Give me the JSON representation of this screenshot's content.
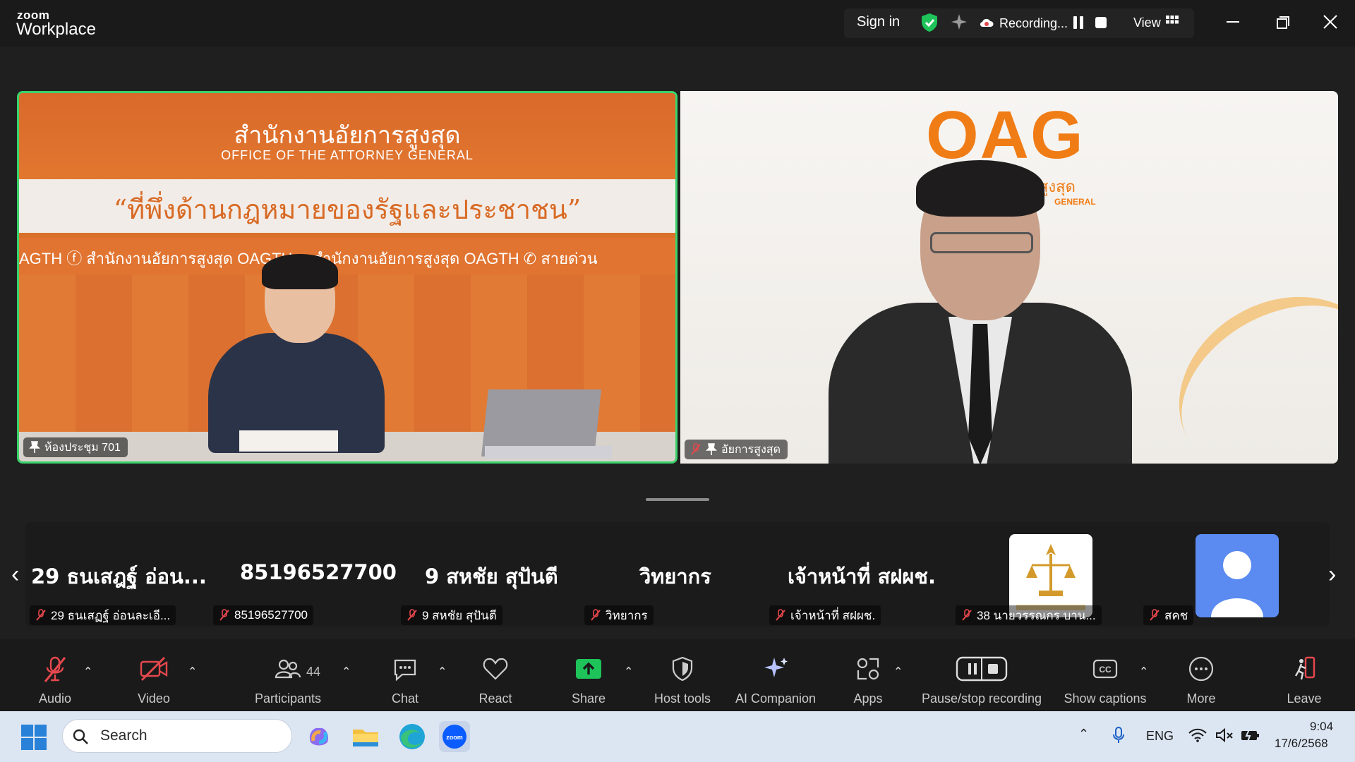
{
  "titlebar": {
    "brand_small": "zoom",
    "brand_big": "Workplace",
    "sign_in": "Sign in",
    "recording_label": "Recording...",
    "view_label": "View"
  },
  "video": {
    "left_scene": {
      "title_th": "สำนักงานอัยการสูงสุด",
      "title_en": "OFFICE OF THE ATTORNEY GENERAL",
      "slogan": "“ที่พึ่งด้านกฎหมายของรัฐและประชาชน”",
      "row": "AGTH   ⓕ สำนักงานอัยการสูงสุด OAGTH   ▶ สำนักงานอัยการสูงสุด OAGTH   ✆ สายด่วน"
    },
    "left_name": "ห้องประชุม 701",
    "right_scene": {
      "logo": "OAG",
      "sub": "สูงสุด",
      "sub2": "GENERAL"
    },
    "right_name": "อัยการสูงสุด"
  },
  "gallery": {
    "tiles": [
      {
        "big": "29 ธนเสฎฐ์  อ่อน...",
        "label": "29 ธนเสฏฐ์  อ่อนละเอี..."
      },
      {
        "big": "85196527700",
        "label": "85196527700"
      },
      {
        "big": "9 สหชัย สุปันตี",
        "label": "9 สหชัย สุปันตี"
      },
      {
        "big": "วิทยากร",
        "label": "วิทยากร"
      },
      {
        "big": "เจ้าหน้าที่ สฝผช.",
        "label": "เจ้าหน้าที่ สฝผช."
      },
      {
        "big": "",
        "label": "38 นายวรรณกร บาน..."
      },
      {
        "big": "",
        "label": "สคช"
      }
    ]
  },
  "toolbar": {
    "audio": "Audio",
    "video": "Video",
    "participants": "Participants",
    "participants_count": "44",
    "chat": "Chat",
    "react": "React",
    "share": "Share",
    "host_tools": "Host tools",
    "ai_companion": "AI Companion",
    "apps": "Apps",
    "pause_stop": "Pause/stop recording",
    "captions": "Show captions",
    "more": "More",
    "leave": "Leave"
  },
  "taskbar": {
    "search_placeholder": "Search",
    "lang": "ENG",
    "time": "9:04",
    "date": "17/6/2568"
  },
  "colors": {
    "active_speaker_border": "#3ad36b",
    "share_green": "#1ec35a",
    "mute_red": "#e5484d",
    "leave_red": "#e5484d",
    "oag_orange": "#f07c16"
  }
}
